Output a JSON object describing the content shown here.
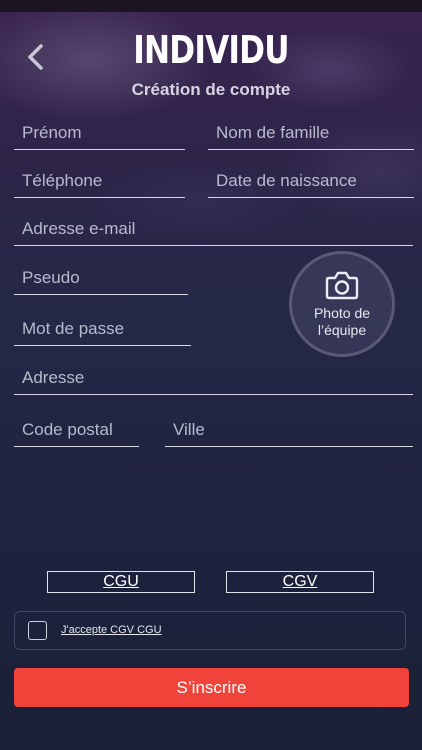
{
  "header": {
    "title": "INDIVIDU",
    "subtitle": "Création de compte"
  },
  "form": {
    "first_name": "Prénom",
    "last_name": "Nom de famille",
    "phone": "Téléphone",
    "birth_date": "Date de naissance",
    "email": "Adresse e-mail",
    "username": "Pseudo",
    "password": "Mot de passe",
    "address": "Adresse",
    "postal_code": "Code postal",
    "city": "Ville"
  },
  "photo": {
    "label": "Photo de l’équipe",
    "icon": "camera-icon"
  },
  "links": {
    "cgu": "CGU",
    "cgv": "CGV"
  },
  "consent": {
    "label": "J'accepte CGV CGU",
    "checked": false
  },
  "submit_label": "S’inscrire",
  "colors": {
    "accent": "#f0443b",
    "underline": "#d6d7e2"
  }
}
